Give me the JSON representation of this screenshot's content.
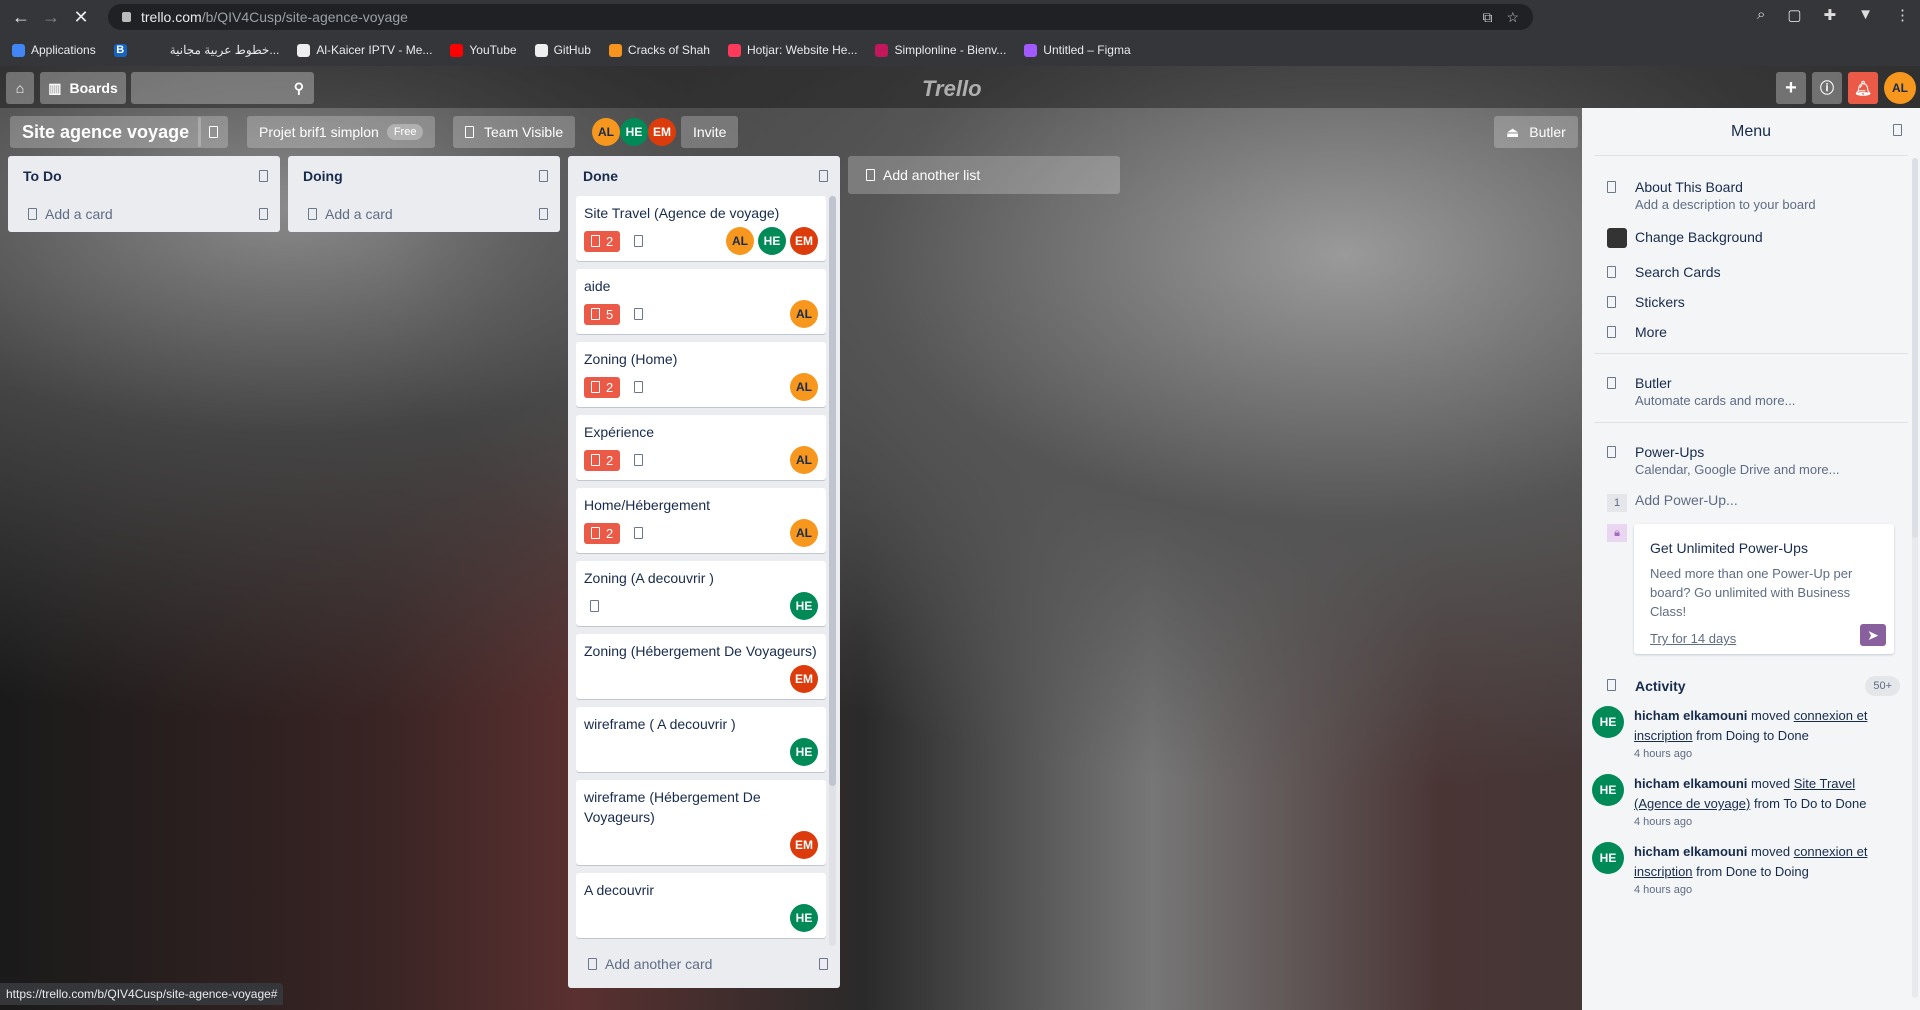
{
  "browser": {
    "url_host": "trello.com",
    "url_path": "/b/QIV4Cusp/site-agence-voyage",
    "status_url": "https://trello.com/b/QIV4Cusp/site-agence-voyage#",
    "bookmarks": [
      {
        "label": "Applications",
        "color": "#4285f4"
      },
      {
        "label": "",
        "color": "#1565c0",
        "text": "B"
      },
      {
        "label": "خطوط عربية مجانية...",
        "color": ""
      },
      {
        "label": "Al-Kaicer IPTV - Me...",
        "color": "#eee"
      },
      {
        "label": "YouTube",
        "color": "#ff0000"
      },
      {
        "label": "GitHub",
        "color": "#eee"
      },
      {
        "label": "Cracks of Shah",
        "color": "#f7941d"
      },
      {
        "label": "Hotjar: Website He...",
        "color": "#fd3a5c"
      },
      {
        "label": "Simplonline - Bienv...",
        "color": "#c2185b"
      },
      {
        "label": "Untitled – Figma",
        "color": "#a259ff"
      }
    ]
  },
  "header": {
    "boards_label": "Boards",
    "logo": "Trello",
    "user_initials": "AL"
  },
  "board": {
    "title": "Site agence voyage",
    "workspace": "Projet brif1 simplon",
    "workspace_badge": "Free",
    "visibility": "Team Visible",
    "members": [
      "AL",
      "HE",
      "EM"
    ],
    "invite_label": "Invite",
    "butler_label": "Butler"
  },
  "lists": [
    {
      "title": "To Do",
      "add_label": "Add a card"
    },
    {
      "title": "Doing",
      "add_label": "Add a card"
    },
    {
      "title": "Done",
      "add_label": "Add another card",
      "cards": [
        {
          "title": "Site Travel (Agence de voyage)",
          "checklist": "2",
          "desc": true,
          "members": [
            "AL",
            "HE",
            "EM"
          ]
        },
        {
          "title": "aide",
          "checklist": "5",
          "desc": true,
          "members": [
            "AL"
          ]
        },
        {
          "title": "Zoning (Home)",
          "checklist": "2",
          "desc": true,
          "members": [
            "AL"
          ]
        },
        {
          "title": "Expérience",
          "checklist": "2",
          "desc": true,
          "members": [
            "AL"
          ]
        },
        {
          "title": "Home/Hébergement",
          "checklist": "2",
          "desc": true,
          "members": [
            "AL"
          ]
        },
        {
          "title": "Zoning (A decouvrir )",
          "checklist": null,
          "desc": true,
          "members": [
            "HE"
          ]
        },
        {
          "title": "Zoning (Hébergement De Voyageurs)",
          "checklist": null,
          "desc": false,
          "members": [
            "EM"
          ]
        },
        {
          "title": "wireframe ( A decouvrir )",
          "checklist": null,
          "desc": false,
          "members": [
            "HE"
          ]
        },
        {
          "title": "wireframe (Hébergement De Voyageurs)",
          "checklist": null,
          "desc": false,
          "members": [
            "EM"
          ]
        },
        {
          "title": "A decouvrir",
          "checklist": null,
          "desc": false,
          "members": [
            "HE"
          ]
        },
        {
          "title": "Héberger De voyageurs",
          "checklist": null,
          "desc": false,
          "members": []
        }
      ]
    }
  ],
  "add_list_label": "Add another list",
  "menu": {
    "title": "Menu",
    "items": [
      {
        "title": "About This Board",
        "sub": "Add a description to your board"
      },
      {
        "title": "Change Background"
      },
      {
        "title": "Search Cards"
      },
      {
        "title": "Stickers"
      },
      {
        "title": "More"
      }
    ],
    "butler": {
      "title": "Butler",
      "sub": "Automate cards and more..."
    },
    "powerups": {
      "title": "Power-Ups",
      "sub": "Calendar, Google Drive and more...",
      "count": "1",
      "add": "Add Power-Up..."
    },
    "promo": {
      "title": "Get Unlimited Power-Ups",
      "body": "Need more than one Power-Up per board? Go unlimited with Business Class!",
      "link": "Try for 14 days"
    },
    "activity": {
      "title": "Activity",
      "count": "50+",
      "items": [
        {
          "initials": "HE",
          "user": "hicham elkamouni",
          "verb": "moved",
          "card": "connexion et inscription",
          "rest": "from Doing to Done",
          "time": "4 hours ago"
        },
        {
          "initials": "HE",
          "user": "hicham elkamouni",
          "verb": "moved",
          "card": "Site Travel (Agence de voyage)",
          "rest": "from To Do to Done",
          "time": "4 hours ago"
        },
        {
          "initials": "HE",
          "user": "hicham elkamouni",
          "verb": "moved",
          "card": "connexion et inscription",
          "rest": "from Done to Doing",
          "time": "4 hours ago"
        }
      ]
    }
  }
}
